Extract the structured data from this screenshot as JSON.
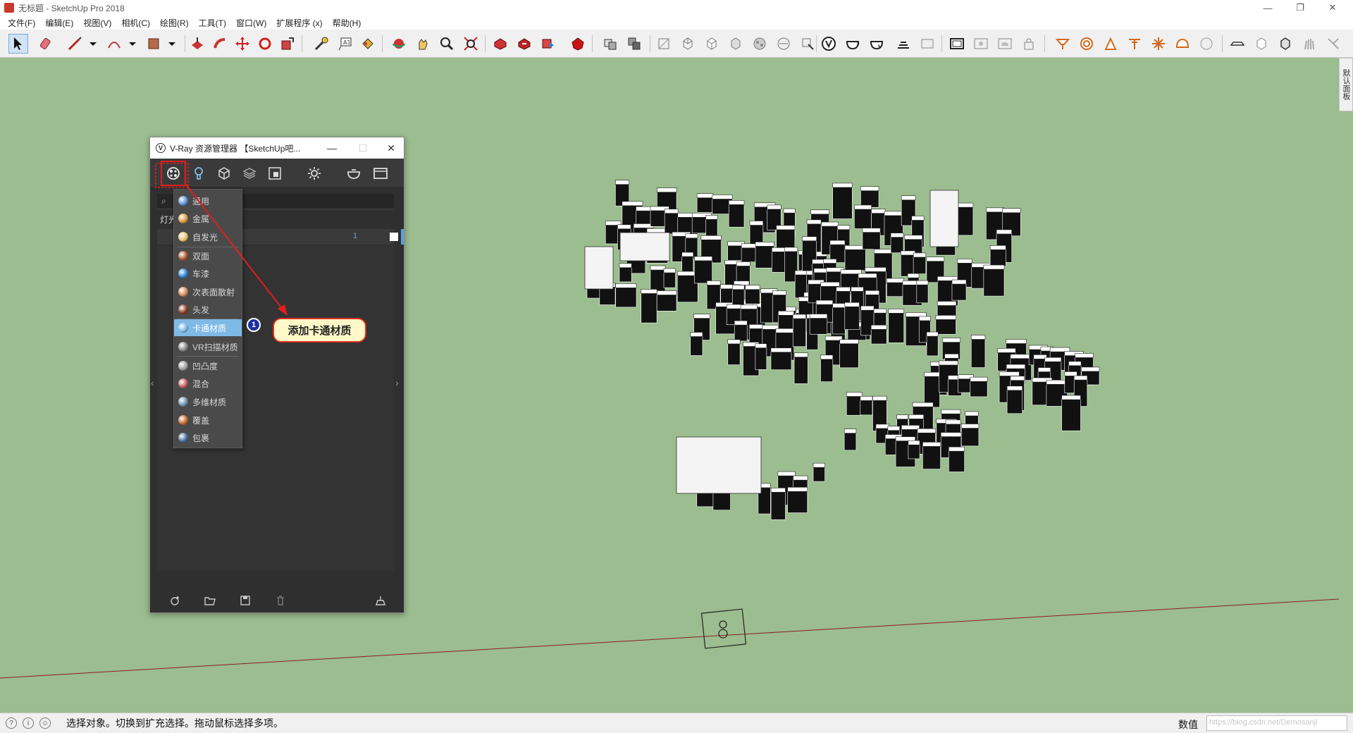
{
  "window": {
    "title": "无标题 - SketchUp Pro 2018",
    "minimize": "—",
    "maximize": "❐",
    "close": "✕"
  },
  "menu": [
    "文件(F)",
    "编辑(E)",
    "视图(V)",
    "相机(C)",
    "绘图(R)",
    "工具(T)",
    "窗口(W)",
    "扩展程序 (x)",
    "帮助(H)"
  ],
  "side_tab": "默认面板",
  "vray": {
    "title": "V-Ray 资源管理器 【SketchUp吧...",
    "minimize": "—",
    "maximize": "☐",
    "close": "✕",
    "panel_head": "灯光",
    "row_count": "1",
    "nav_left": "‹",
    "nav_right": "›",
    "material_menu": [
      {
        "label": "通用",
        "color": "#5b8fd6"
      },
      {
        "label": "金属",
        "color": "#d69a3b"
      },
      {
        "label": "自发光",
        "color": "#e9c16b"
      },
      {
        "label": "双面",
        "color": "#a8562c"
      },
      {
        "label": "车漆",
        "color": "#2a7fd8"
      },
      {
        "label": "次表面散射",
        "color": "#d38a5a"
      },
      {
        "label": "头发",
        "color": "#8a3b22"
      },
      {
        "label": "卡通材质",
        "color": "#7fb9e6"
      },
      {
        "label": "VR扫描材质",
        "color": "#888888"
      },
      {
        "label": "凹凸度",
        "color": "#9a9a9a"
      },
      {
        "label": "混合",
        "color": "#c05a5a"
      },
      {
        "label": "多维材质",
        "color": "#6a8fb0"
      },
      {
        "label": "覆盖",
        "color": "#c86a30"
      },
      {
        "label": "包裹",
        "color": "#4a6fa0"
      }
    ],
    "selected_item": "卡通材质"
  },
  "callout": {
    "step": "1",
    "text": "添加卡通材质"
  },
  "status": {
    "message": "选择对象。切换到扩充选择。拖动鼠标选择多项。",
    "measure_label": "数值",
    "watermark": "https://blog.csdn.net/Demosanji"
  },
  "colors": {
    "viewport": "#9bbd8f",
    "accent_red": "#e01e1e",
    "selected_item": "#7fb9e6"
  }
}
